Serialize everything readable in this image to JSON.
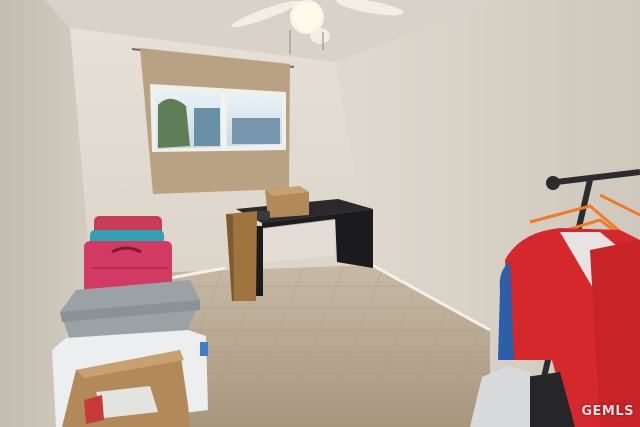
{
  "scene": {
    "description_label": "room-photo",
    "colors": {
      "ceiling": "#dcd7cf",
      "back_wall": "#e2ddd3",
      "right_wall": "#d9d3c8",
      "left_wall": "#cfc8bc",
      "floor": "#b7a68f",
      "curtain": "#b9a284",
      "desk": "#2a2a2c",
      "suitcase_pink": "#d23a64",
      "suitcase_teal": "#2fa3b4",
      "bin": "#9ba2a6",
      "jacket_red": "#d4282c",
      "hanger_orange": "#f07a28",
      "box": "#b28a5a"
    }
  },
  "watermark": {
    "text": "GEMLS"
  }
}
